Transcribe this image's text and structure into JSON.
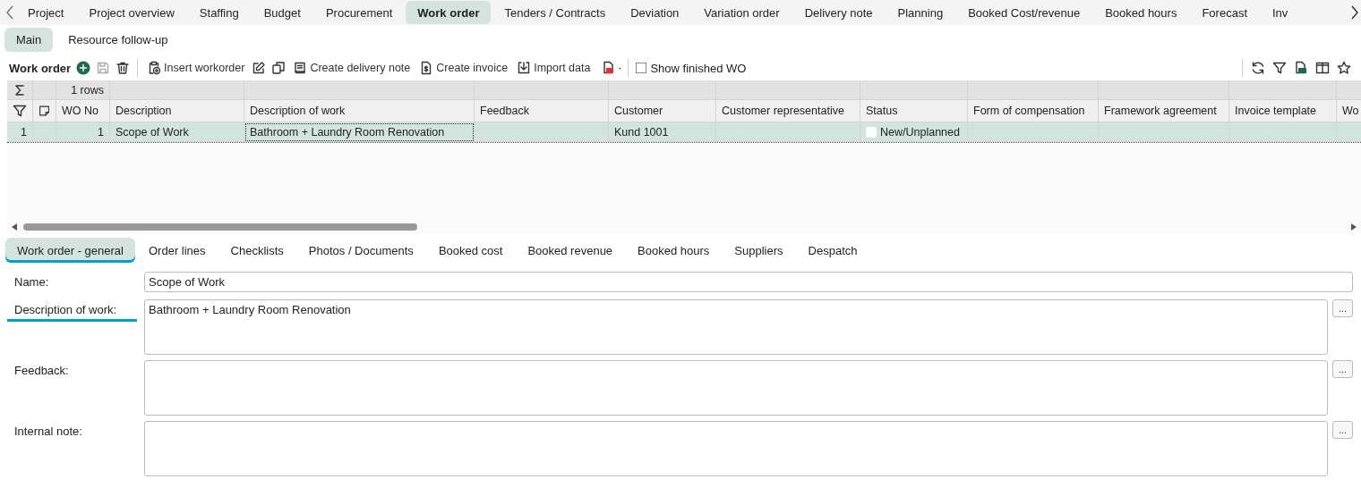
{
  "top_tabs": [
    {
      "label": "Project",
      "selected": false
    },
    {
      "label": "Project overview",
      "selected": false
    },
    {
      "label": "Staffing",
      "selected": false
    },
    {
      "label": "Budget",
      "selected": false
    },
    {
      "label": "Procurement",
      "selected": false
    },
    {
      "label": "Work order",
      "selected": true
    },
    {
      "label": "Tenders / Contracts",
      "selected": false
    },
    {
      "label": "Deviation",
      "selected": false
    },
    {
      "label": "Variation order",
      "selected": false
    },
    {
      "label": "Delivery note",
      "selected": false
    },
    {
      "label": "Planning",
      "selected": false
    },
    {
      "label": "Booked Cost/revenue",
      "selected": false
    },
    {
      "label": "Booked hours",
      "selected": false
    },
    {
      "label": "Forecast",
      "selected": false
    },
    {
      "label": "Inv",
      "selected": false
    }
  ],
  "sub_tabs": [
    {
      "label": "Main",
      "selected": true
    },
    {
      "label": "Resource follow-up",
      "selected": false
    }
  ],
  "toolbar": {
    "title": "Work order",
    "items": [
      {
        "kind": "add",
        "disabled": false
      },
      {
        "kind": "save",
        "disabled": true
      },
      {
        "kind": "delete",
        "disabled": false
      },
      {
        "kind": "insert",
        "label": "Insert workorder",
        "disabled": false
      },
      {
        "kind": "edit",
        "disabled": false
      },
      {
        "kind": "copy",
        "disabled": false
      },
      {
        "kind": "book",
        "label": "Create delivery note",
        "disabled": false
      },
      {
        "kind": "invoice",
        "label": "Create invoice",
        "disabled": false
      },
      {
        "kind": "import",
        "label": "Import data",
        "disabled": false
      },
      {
        "kind": "pdf",
        "disabled": false
      }
    ],
    "show_finished": {
      "label": "Show finished WO",
      "checked": false
    },
    "right_icons": [
      {
        "kind": "refresh"
      },
      {
        "kind": "filter"
      },
      {
        "kind": "excel"
      },
      {
        "kind": "columns"
      },
      {
        "kind": "star"
      }
    ]
  },
  "grid": {
    "summary": "1 rows",
    "columns": [
      {
        "kind": "filter"
      },
      {
        "kind": "note"
      },
      {
        "kind": "number",
        "label": "WO No"
      },
      {
        "kind": "text",
        "label": "Description"
      },
      {
        "kind": "text",
        "label": "Description of work"
      },
      {
        "kind": "text",
        "label": "Feedback"
      },
      {
        "kind": "text",
        "label": "Customer"
      },
      {
        "kind": "text",
        "label": "Customer representative"
      },
      {
        "kind": "status",
        "label": "Status"
      },
      {
        "kind": "text",
        "label": "Form of compensation"
      },
      {
        "kind": "text",
        "label": "Framework agreement"
      },
      {
        "kind": "text",
        "label": "Invoice template"
      },
      {
        "kind": "text",
        "label": "Wo"
      }
    ],
    "rows": [
      {
        "selected": true,
        "cells": [
          "1",
          "",
          "1",
          "Scope of Work",
          "Bathroom + Laundry Room Renovation",
          "",
          "Kund 1001",
          "",
          "New/Unplanned",
          "",
          "",
          "",
          ""
        ]
      }
    ]
  },
  "detail_tabs": [
    {
      "label": "Work order - general",
      "selected": true
    },
    {
      "label": "Order lines",
      "selected": false
    },
    {
      "label": "Checklists",
      "selected": false
    },
    {
      "label": "Photos / Documents",
      "selected": false
    },
    {
      "label": "Booked cost",
      "selected": false
    },
    {
      "label": "Booked revenue",
      "selected": false
    },
    {
      "label": "Booked hours",
      "selected": false
    },
    {
      "label": "Suppliers",
      "selected": false
    },
    {
      "label": "Despatch",
      "selected": false
    }
  ],
  "fields": [
    {
      "kind": "input",
      "label": "Name:",
      "value": "Scope of Work",
      "focused": false
    },
    {
      "kind": "textarea",
      "label": "Description of work:",
      "value": "Bathroom + Laundry Room Renovation",
      "focused": true,
      "more": "..."
    },
    {
      "kind": "textarea",
      "label": "Feedback:",
      "focused": false,
      "more": "..."
    },
    {
      "kind": "textarea",
      "label": "Internal note:",
      "focused": false,
      "more": "..."
    }
  ]
}
